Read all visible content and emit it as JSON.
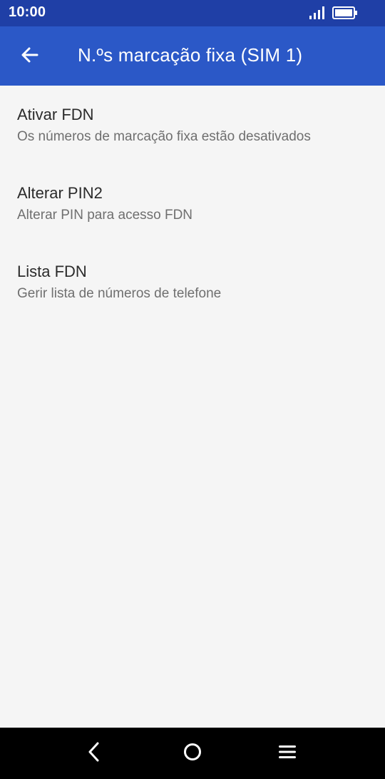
{
  "status_bar": {
    "time": "10:00",
    "icons": [
      "signal-icon",
      "battery-icon"
    ]
  },
  "app_bar": {
    "title": "N.ºs marcação fixa (SIM 1)",
    "back_icon": "arrow-back-icon"
  },
  "items": [
    {
      "title": "Ativar FDN",
      "subtitle": "Os números de marcação fixa estão desativados"
    },
    {
      "title": "Alterar PIN2",
      "subtitle": "Alterar PIN para acesso FDN"
    },
    {
      "title": "Lista FDN",
      "subtitle": "Gerir lista de números de telefone"
    }
  ],
  "nav_bar": {
    "icons": [
      "back-triangle-icon",
      "home-circle-icon",
      "menu-lines-icon"
    ]
  },
  "colors": {
    "status_bar": "#1f3fa6",
    "app_bar": "#2b58c7",
    "background": "#f5f5f5",
    "nav_bar": "#000000"
  }
}
